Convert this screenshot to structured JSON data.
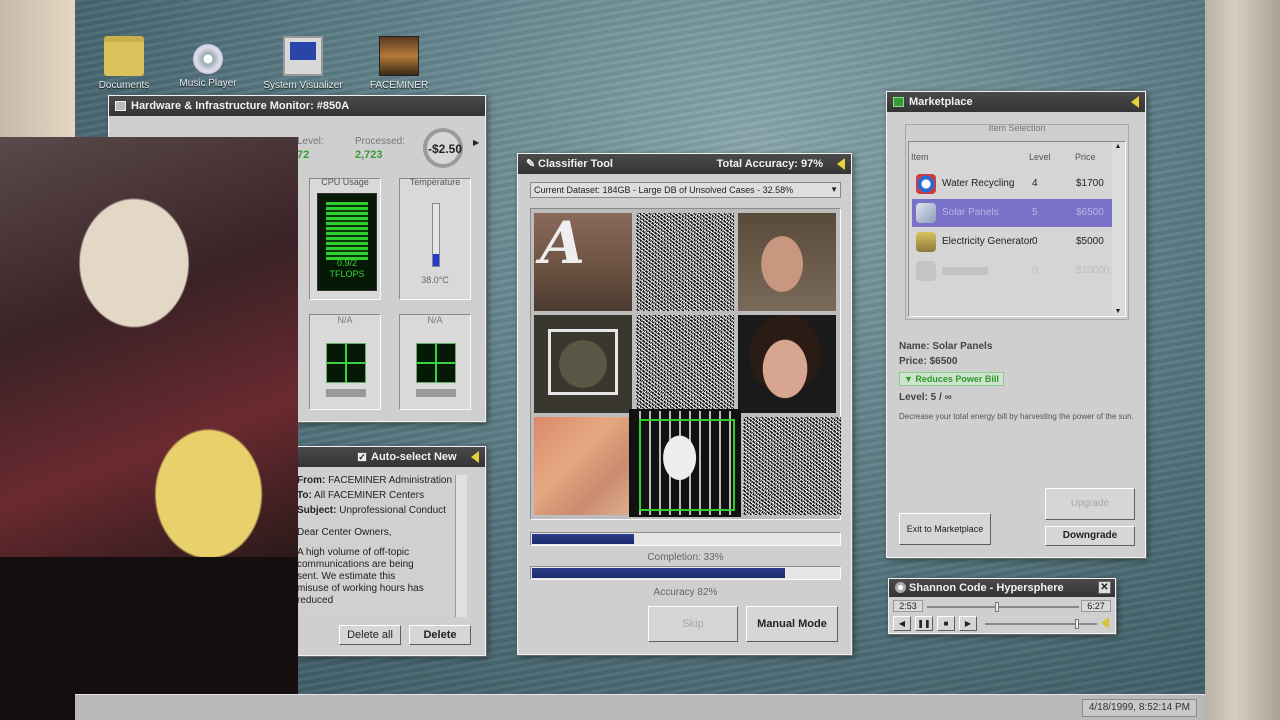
{
  "desktop": {
    "icons": [
      {
        "label": "Documents",
        "icon": "folder-icon"
      },
      {
        "label": "Music Player",
        "icon": "music-cd-icon"
      },
      {
        "label": "System Visualizer",
        "icon": "monitor-icon"
      },
      {
        "label": "FACEMINER",
        "icon": "eye-icon"
      }
    ],
    "clock": "4/18/1999, 8:52:14 PM"
  },
  "hardware": {
    "title": "Hardware & Infrastructure Monitor: #850A",
    "level_label": "Level:",
    "level_value": "72",
    "processed_label": "Processed:",
    "processed_value": "2,723",
    "balance": "-$2.50",
    "cpu_label": "CPU Usage",
    "cpu_value": "0.9/2",
    "cpu_unit": "TFLOPS",
    "temp_label": "Temperature",
    "temp_value": "38.0°C",
    "temp_fill": 0.2,
    "na1": "N/A",
    "na2": "N/A"
  },
  "mail": {
    "title": "Auto-select New",
    "from_label": "From:",
    "from_value": "FACEMINER Administration",
    "to_label": "To:",
    "to_value": "All FACEMINER Centers",
    "subject_label": "Subject:",
    "subject_value": "Unprofessional Conduct",
    "greeting": "Dear Center Owners,",
    "body": "A high volume of off-topic communications are being sent. We estimate this misuse of working hours has reduced",
    "delete_all": "Delete all",
    "delete": "Delete"
  },
  "classifier": {
    "title": "Classifier Tool",
    "total_accuracy": "Total Accuracy: 97%",
    "dataset": "Current Dataset: 184GB - Large DB of Unsolved Cases - 32.58%",
    "tile_letter": "A",
    "completion_label": "Completion: 33%",
    "completion_value": 0.33,
    "accuracy_label": "Accuracy 82%",
    "accuracy_value": 0.82,
    "skip": "Skip",
    "manual_mode": "Manual Mode"
  },
  "marketplace": {
    "title": "Marketplace",
    "section": "Item Selection",
    "col_item": "Item",
    "col_level": "Level",
    "col_price": "Price",
    "items": [
      {
        "name": "Water Recycling",
        "level": "4",
        "price": "$1700"
      },
      {
        "name": "Solar Panels",
        "level": "5",
        "price": "$6500"
      },
      {
        "name": "Electricity Generator",
        "level": "0",
        "price": "$5000"
      },
      {
        "name": "",
        "level": "0",
        "price": "$10000"
      }
    ],
    "detail_name": "Name: Solar Panels",
    "detail_price": "Price: $6500",
    "detail_badge": "▼ Reduces Power Bill",
    "detail_level": "Level: 5 / ∞",
    "detail_desc": "Decrease your total energy bill by harvesting the power of the sun.",
    "exit": "Exit to Marketplace",
    "upgrade": "Upgrade",
    "downgrade": "Downgrade"
  },
  "player": {
    "title": "Shannon Code - Hypersphere",
    "elapsed": "2:53",
    "total": "6:27",
    "progress": 0.45,
    "volume": 0.8
  }
}
